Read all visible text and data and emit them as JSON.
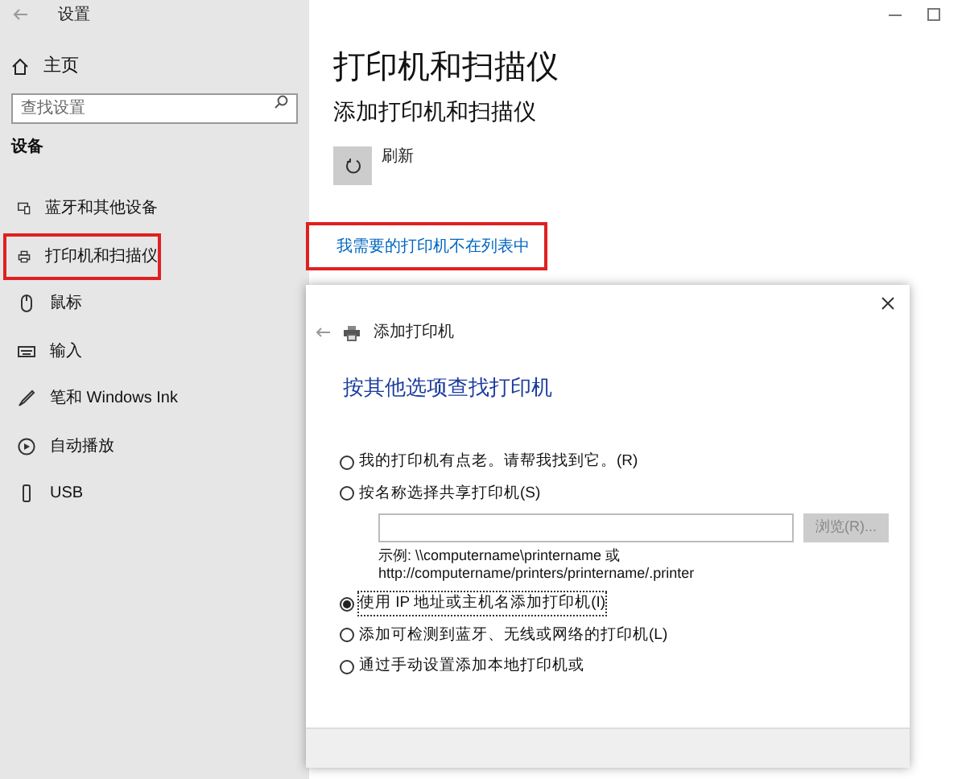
{
  "window": {
    "title": "设置"
  },
  "sidebar": {
    "home": "主页",
    "search": {
      "placeholder": "查找设置"
    },
    "section": "设备",
    "items": [
      {
        "label": "蓝牙和其他设备",
        "highlighted": false
      },
      {
        "label": "打印机和扫描仪",
        "highlighted": true
      },
      {
        "label": "鼠标",
        "highlighted": false
      },
      {
        "label": "输入",
        "highlighted": false
      },
      {
        "label": "笔和 Windows Ink",
        "highlighted": false
      },
      {
        "label": "自动播放",
        "highlighted": false
      },
      {
        "label": "USB",
        "highlighted": false
      }
    ]
  },
  "main": {
    "title": "打印机和扫描仪",
    "subtitle": "添加打印机和扫描仪",
    "refresh": "刷新",
    "link": {
      "label": "我需要的打印机不在列表中",
      "highlighted": true
    }
  },
  "dialog": {
    "title": "添加打印机",
    "heading": "按其他选项查找打印机",
    "options": [
      {
        "label": "我的打印机有点老。请帮我找到它。(R)",
        "selected": false
      },
      {
        "label": "按名称选择共享打印机(S)",
        "selected": false,
        "kind": "shared"
      },
      {
        "label": "使用 IP 地址或主机名添加打印机(I)",
        "selected": true
      },
      {
        "label": "添加可检测到蓝牙、无线或网络的打印机(L)",
        "selected": false
      },
      {
        "label": "通过手动设置添加本地打印机或",
        "selected": false
      }
    ],
    "browse": {
      "label": "浏览(R)...",
      "disabled": true
    },
    "example": [
      "示例: \\\\computername\\printername 或",
      "http://computername/printers/printername/.printer"
    ]
  }
}
